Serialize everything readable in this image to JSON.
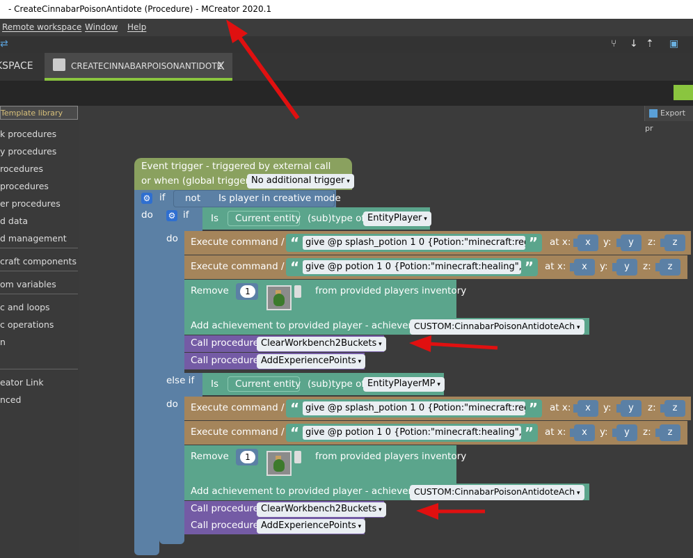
{
  "window": {
    "title": "- CreateCinnabarPoisonAntidote (Procedure) - MCreator 2020.1"
  },
  "menu": {
    "items": [
      "Remote workspace",
      "Window",
      "Help"
    ]
  },
  "tabs": {
    "workspace": "KSPACE",
    "procedure": "CREATECINNABARPOISONANTIDOTE",
    "close": "X"
  },
  "sidebar": {
    "template_library": "Template library",
    "items": [
      "k procedures",
      "y procedures",
      "rocedures",
      "procedures",
      "er procedures",
      "d data",
      "d management",
      "craft components",
      "om variables",
      "c and loops",
      "c operations",
      "n",
      "eator Link",
      "nced"
    ]
  },
  "toolbar": {
    "export_label": "Export pr"
  },
  "blocks": {
    "event": {
      "line1": "Event trigger - triggered by external call",
      "line2": "or when (global trigger):",
      "trigger": "No additional trigger"
    },
    "if_label": "if",
    "do_label": "do",
    "else_if_label": "else if",
    "not_label": "not",
    "creative_mode": "Is player in creative mode",
    "is_label": "Is",
    "current_entity": "Current entity",
    "subtype_of": "(sub)type of",
    "entity_player": "EntityPlayer",
    "entity_player_mp": "EntityPlayerMP",
    "execute_command": "Execute command /",
    "cmd_splash": "give @p splash_potion 1 0 {Potion:\"minecraft:reg...",
    "cmd_potion": "give @p potion 1 0 {Potion:\"minecraft:healing\",C...",
    "at_x": "at x:",
    "y_label": "y:",
    "z_label": "z:",
    "x_var": "x",
    "y_var": "y",
    "z_var": "z",
    "remove": "Remove",
    "remove_count": "1",
    "from_inventory": "from provided players inventory",
    "add_achievement": "Add achievement to provided player - achievement:",
    "achievement_value": "CUSTOM:CinnabarPoisonAntidoteAch",
    "call_procedure": "Call procedure",
    "proc_clear": "ClearWorkbench2Buckets",
    "proc_xp": "AddExperiencePoints"
  },
  "colors": {
    "event": "#8aa15f",
    "logic": "#5b80a5",
    "entity": "#5ba58c",
    "command": "#a5855b",
    "procedure": "#745ba5",
    "arrow": "#e01010",
    "tab_accent": "#8ac53f"
  }
}
